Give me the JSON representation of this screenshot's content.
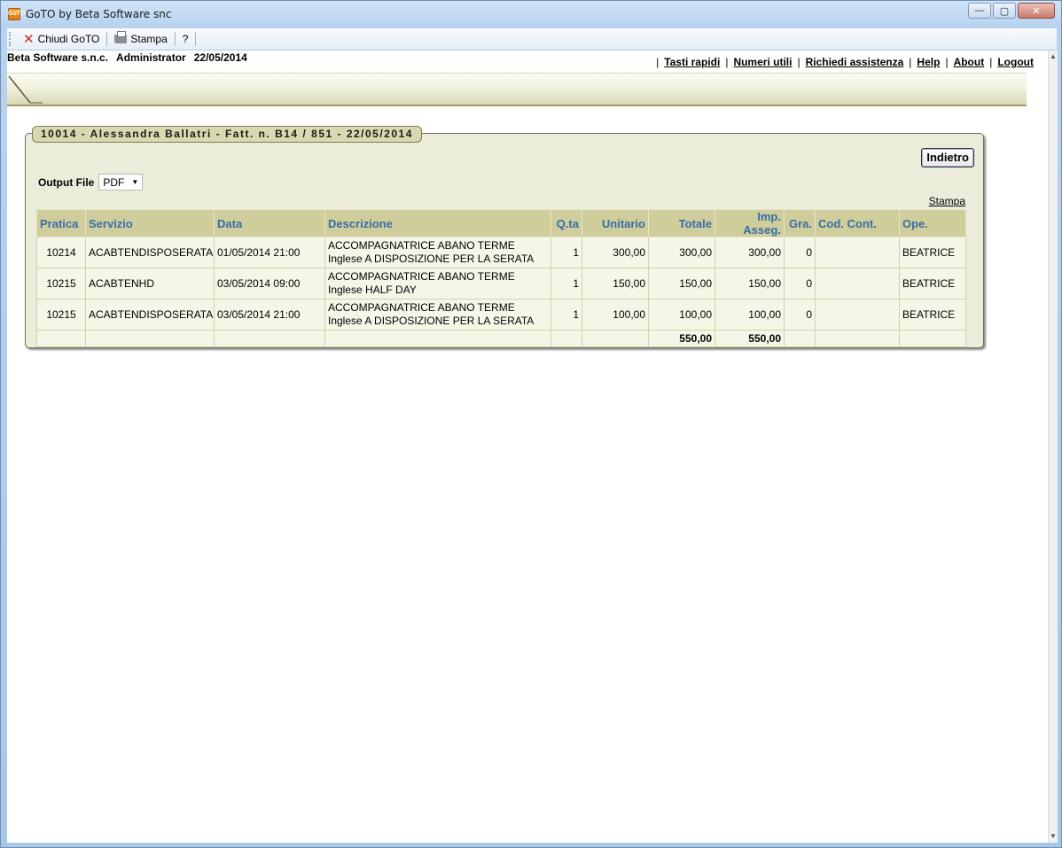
{
  "window": {
    "title": "GoTO by Beta Software snc",
    "icon_text": "GoTO",
    "controls": {
      "minimize": "—",
      "maximize": "▢",
      "close": "✕"
    }
  },
  "toolbar": {
    "close_label": "Chiudi GoTO",
    "print_label": "Stampa",
    "help_label": "?"
  },
  "header": {
    "company": "Beta Software s.n.c.",
    "user": "Administrator",
    "date": "22/05/2014",
    "links": [
      "Tasti rapidi",
      "Numeri utili",
      "Richiedi assistenza",
      "Help",
      "About",
      "Logout"
    ],
    "link_separator": "|"
  },
  "panel": {
    "legend": "10014 - Alessandra Ballatri - Fatt. n. B14 / 851 - 22/05/2014",
    "back_button": "Indietro",
    "output_label": "Output File",
    "output_value": "PDF",
    "print_link": "Stampa"
  },
  "table": {
    "columns": [
      "Pratica",
      "Servizio",
      "Data",
      "Descrizione",
      "Q.ta",
      "Unitario",
      "Totale",
      "Imp. Asseg.",
      "Gra.",
      "Cod. Cont.",
      "Ope."
    ],
    "rows": [
      {
        "pratica": "10214",
        "servizio": "ACABTENDISPOSERATA",
        "data": "01/05/2014 21:00",
        "descrizione": "ACCOMPAGNATRICE ABANO TERME Inglese A DISPOSIZIONE PER LA SERATA",
        "qta": "1",
        "unitario": "300,00",
        "totale": "300,00",
        "imp_asseg": "300,00",
        "gra": "0",
        "cod_cont": "",
        "ope": "BEATRICE"
      },
      {
        "pratica": "10215",
        "servizio": "ACABTENHD",
        "data": "03/05/2014 09:00",
        "descrizione": "ACCOMPAGNATRICE ABANO TERME Inglese HALF DAY",
        "qta": "1",
        "unitario": "150,00",
        "totale": "150,00",
        "imp_asseg": "150,00",
        "gra": "0",
        "cod_cont": "",
        "ope": "BEATRICE"
      },
      {
        "pratica": "10215",
        "servizio": "ACABTENDISPOSERATA",
        "data": "03/05/2014 21:00",
        "descrizione": "ACCOMPAGNATRICE ABANO TERME Inglese A DISPOSIZIONE PER LA SERATA",
        "qta": "1",
        "unitario": "100,00",
        "totale": "100,00",
        "imp_asseg": "100,00",
        "gra": "0",
        "cod_cont": "",
        "ope": "BEATRICE"
      }
    ],
    "totals": {
      "totale": "550,00",
      "imp_asseg": "550,00"
    }
  }
}
